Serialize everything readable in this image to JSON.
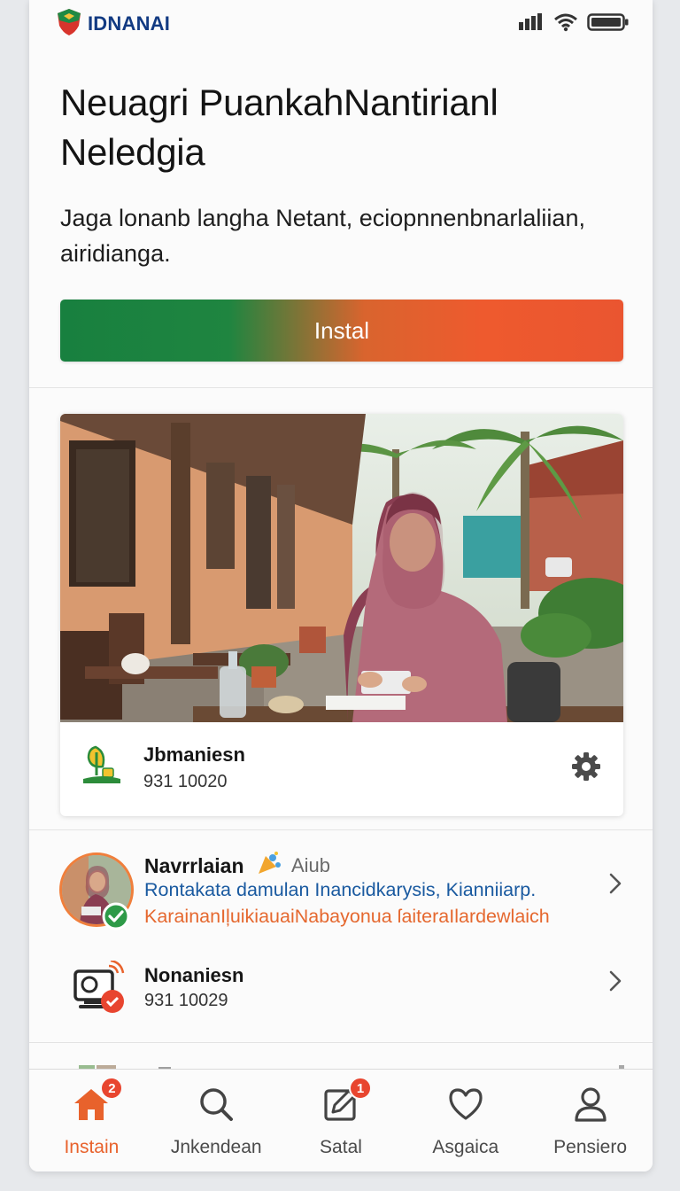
{
  "app": {
    "brand": "IDNANAI"
  },
  "hero": {
    "title_line1": "Neuagri PuankahNantirianl",
    "title_line2": "Neledgia",
    "subtitle_line1": "Jaga lonanb langha Netant, ecioрnnenbnarlaliian,",
    "subtitle_line2": "airidianga."
  },
  "install": {
    "label": "Instal"
  },
  "featured": {
    "name": "Jbmaniesn",
    "code": "931 10020"
  },
  "list": [
    {
      "title": "Navrrlaian",
      "tag": "Aiub",
      "line2": "Rontakata damulan Inancidkarysis, Kianniiarp.",
      "line3": "KarainanIļuikiauaiNabayonuа ſaiteraIlardewlaich"
    },
    {
      "title": "Nonaniesn",
      "code": "931 10029"
    }
  ],
  "nav": {
    "items": [
      {
        "label": "Instain",
        "badge": "2"
      },
      {
        "label": "Jnkendean"
      },
      {
        "label": "Satal",
        "badge": "1"
      },
      {
        "label": "Asgaica"
      },
      {
        "label": "Pensiero"
      }
    ]
  },
  "colors": {
    "brand_blue": "#123a82",
    "accent_orange": "#e8622c",
    "accent_green": "#18803f",
    "link_blue": "#1a5aa0",
    "badge_red": "#e8452f"
  },
  "icons": {
    "brand": "shield-logo-icon",
    "status": [
      "signal-icon",
      "wifi-icon",
      "battery-icon"
    ],
    "featured_logo": "plant-logo-icon",
    "featured_action": "gear-icon",
    "list_chevron": "chevron-right-icon",
    "device": "monitor-icon",
    "nav": [
      "home-icon",
      "search-icon",
      "edit-icon",
      "heart-icon",
      "user-icon"
    ]
  }
}
